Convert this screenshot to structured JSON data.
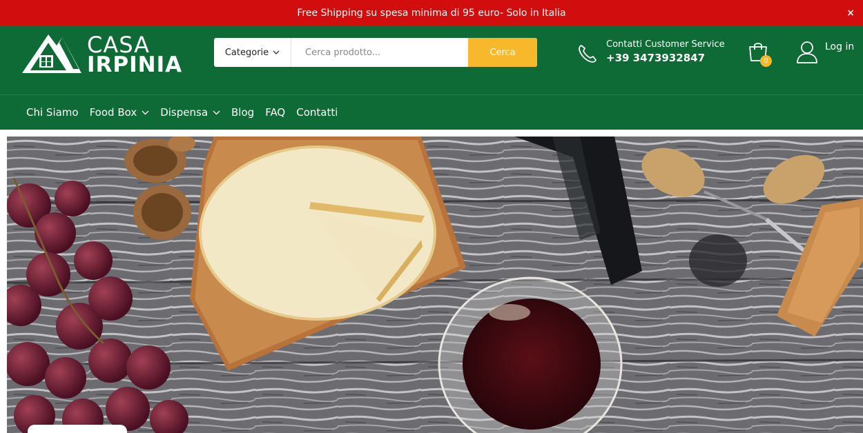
{
  "promo": {
    "text": "Free Shipping su spesa minima di 95 euro- Solo in Italia",
    "close": "×"
  },
  "logo": {
    "line1": "CASA",
    "line2": "IRPINIA"
  },
  "search": {
    "category_label": "Categorie",
    "placeholder": "Cerca prodotto...",
    "button_label": "Cerca"
  },
  "contact": {
    "label": "Contatti Customer Service",
    "phone": "+39 3473932847"
  },
  "cart": {
    "count": "0"
  },
  "login": {
    "label": "Log in"
  },
  "nav": {
    "items": [
      {
        "label": "Chi Siamo"
      },
      {
        "label": "Food Box"
      },
      {
        "label": "Dispensa"
      },
      {
        "label": "Blog"
      },
      {
        "label": "FAQ"
      },
      {
        "label": "Contatti"
      }
    ]
  },
  "colors": {
    "promo_bg": "#d10d0d",
    "header_bg": "#0f6b35",
    "accent": "#f7b92b"
  },
  "icons": [
    "phone-icon",
    "cart-icon",
    "user-icon",
    "chevron-down-icon",
    "close-icon"
  ]
}
